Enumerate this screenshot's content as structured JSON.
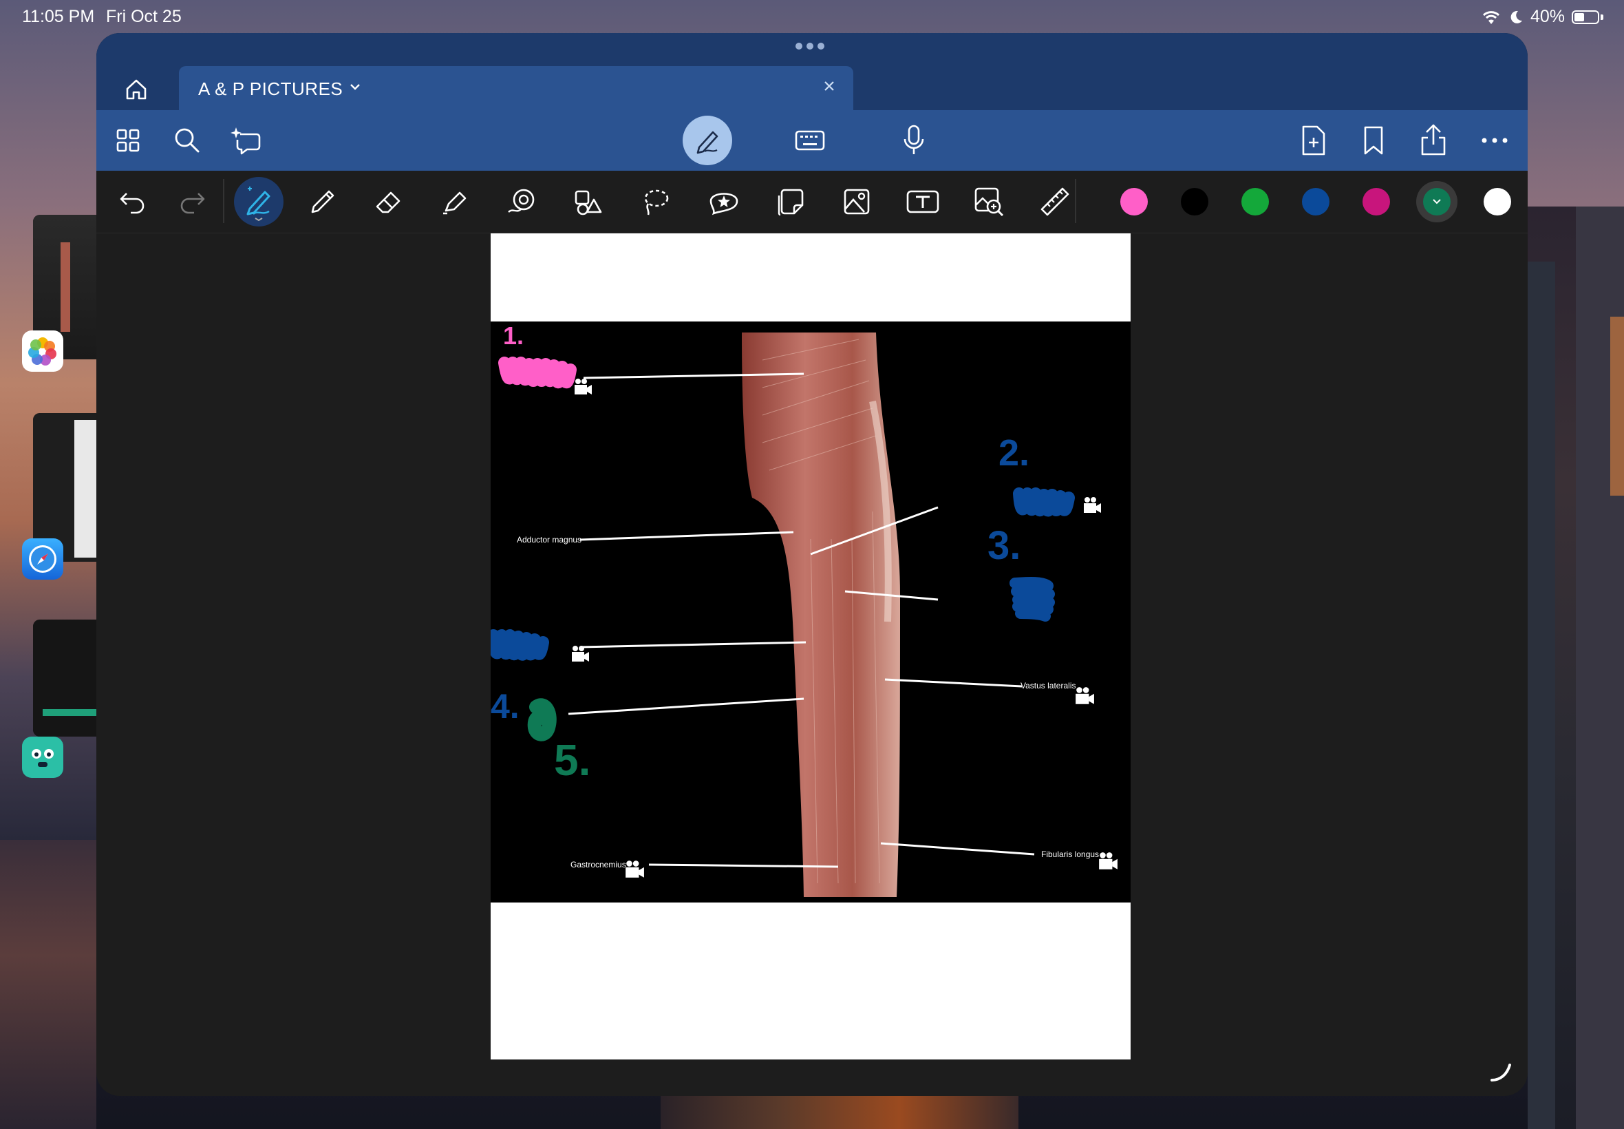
{
  "status_bar": {
    "time": "11:05 PM",
    "date": "Fri Oct 25",
    "battery": "40%"
  },
  "tab": {
    "title": "A & P PICTURES"
  },
  "top_toolbar": {
    "left_icons": [
      "thumbnails-icon",
      "search-icon",
      "ai-assistant-icon"
    ],
    "center_icons": [
      "pen-mode-icon",
      "keyboard-icon",
      "microphone-icon"
    ],
    "right_icons": [
      "add-page-icon",
      "bookmark-icon",
      "share-icon",
      "more-icon"
    ]
  },
  "tools_toolbar": {
    "tools": [
      "undo-icon",
      "redo-icon",
      "fountain-pen-icon",
      "pencil-icon",
      "eraser-icon",
      "highlighter-icon",
      "shape-icon",
      "elements-icon",
      "lasso-icon",
      "sticker-icon",
      "sticky-note-icon",
      "image-icon",
      "text-box-icon",
      "zoom-window-icon",
      "ruler-icon"
    ],
    "colors": [
      "#ff5fc8",
      "#000000",
      "#14a83a",
      "#0b4a9a",
      "#c8157c",
      "#0f7a55",
      "#ffffff"
    ],
    "selected_color": "#0f7a55"
  },
  "document": {
    "labels": {
      "adductor_magnus": "Adductor magnus",
      "vastus_lateralis": "Vastus lateralis",
      "gastrocnemius": "Gastrocnemius",
      "fibularis_longus": "Fibularis longus"
    },
    "annotations": {
      "n1": "1.",
      "n2": "2.",
      "n3": "3.",
      "n4": "4.",
      "n5": "5."
    },
    "annotation_colors": {
      "pink": "#ff5fc8",
      "blue": "#0b4a9a",
      "green": "#0f7a55"
    }
  }
}
